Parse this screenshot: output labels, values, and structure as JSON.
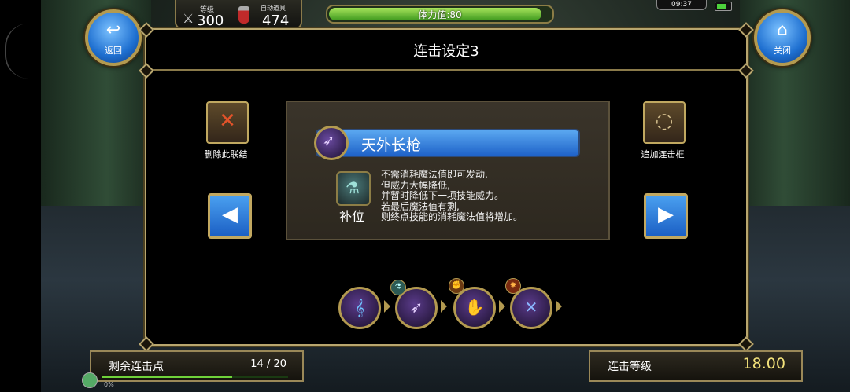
{
  "hud": {
    "level_label": "等级",
    "level_value": "300",
    "auto_item_label": "自动道具",
    "auto_item_value": "474",
    "stamina_text": "体力值:80",
    "stamina_fraction": 0.97,
    "clock": "09:37"
  },
  "nav": {
    "back_label": "返回",
    "close_label": "关闭"
  },
  "panel": {
    "title": "连击设定3",
    "delete_label": "删除此联结",
    "add_label": "追加连击框"
  },
  "skill": {
    "name": "天外长枪",
    "position_label": "补位",
    "description": [
      "不需消耗魔法值即可发动,",
      "但威力大幅降低,",
      "并暂时降低下一项技能威力。",
      "若最后魔法值有剩,",
      "则终点技能的消耗魔法值将增加。"
    ]
  },
  "combo_chain": [
    {
      "icon": "wind-blade-icon",
      "badge": ""
    },
    {
      "icon": "lance-icon",
      "badge": "potion"
    },
    {
      "icon": "palm-strike-icon",
      "badge": "fist"
    },
    {
      "icon": "cross-slash-icon",
      "badge": "burst"
    }
  ],
  "bottom": {
    "combo_points_label": "剩余连击点",
    "combo_points_value": "14 / 20",
    "combo_points_fraction": 0.7,
    "combo_level_label": "连击等级",
    "combo_level_value": "18.00",
    "bottom_left_text": "0%"
  },
  "colors": {
    "gold_border": "#b8a66e",
    "button_blue": "#1f63c9",
    "stamina_green": "#5fbf2f",
    "level_value_yellow": "#f3e27a"
  }
}
